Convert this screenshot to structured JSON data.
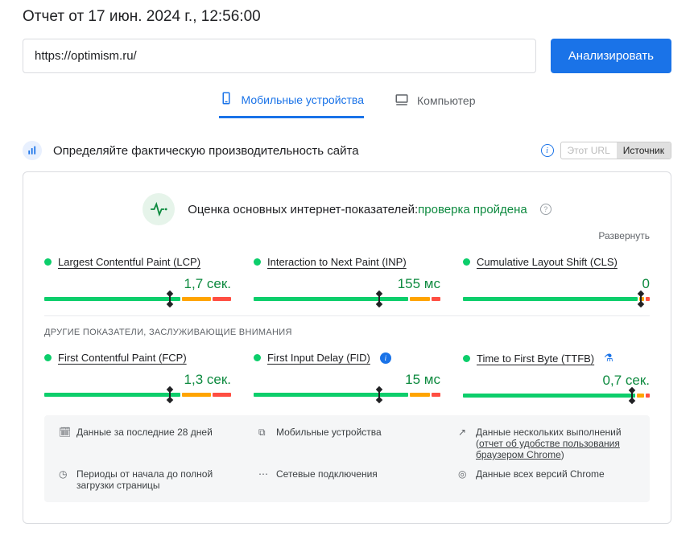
{
  "report_title": "Отчет от 17 июн. 2024 г., 12:56:00",
  "url_value": "https://optimism.ru/",
  "analyze_label": "Анализировать",
  "tabs": {
    "mobile": "Мобильные устройства",
    "desktop": "Компьютер"
  },
  "section": {
    "title": "Определяйте фактическую производительность сайта",
    "toggle_this_url": "Этот URL",
    "toggle_source": "Источник"
  },
  "assessment": {
    "prefix": "Оценка основных интернет-показателей:",
    "result": "проверка пройдена",
    "expand": "Развернуть"
  },
  "metrics_core": [
    {
      "name": "Largest Contentful Paint (LCP)",
      "value": "1,7 сек.",
      "bar": [
        74,
        16,
        10
      ],
      "marker": 67
    },
    {
      "name": "Interaction to Next Paint (INP)",
      "value": "155 мс",
      "bar": [
        84,
        11,
        5
      ],
      "marker": 67
    },
    {
      "name": "Cumulative Layout Shift (CLS)",
      "value": "0",
      "bar": [
        95,
        3,
        2
      ],
      "marker": 95
    }
  ],
  "other_heading": "ДРУГИЕ ПОКАЗАТЕЛИ, ЗАСЛУЖИВАЮЩИЕ ВНИМАНИЯ",
  "metrics_other": [
    {
      "name": "First Contentful Paint (FCP)",
      "value": "1,3 сек.",
      "bar": [
        74,
        16,
        10
      ],
      "marker": 67,
      "suffix": ""
    },
    {
      "name": "First Input Delay (FID)",
      "value": "15 мс",
      "bar": [
        84,
        11,
        5
      ],
      "marker": 67,
      "suffix": "info"
    },
    {
      "name": "Time to First Byte (TTFB)",
      "value": "0,7 сек.",
      "bar": [
        94,
        4,
        2
      ],
      "marker": 90,
      "suffix": "flask"
    }
  ],
  "footer": {
    "period_28": "Данные за последние 28 дней",
    "mobile": "Мобильные устройства",
    "multi_runs": "Данные нескольких выполнений (",
    "multi_runs_link": "отчет об удобстве пользования браузером Chrome",
    "multi_runs_close": ")",
    "full_load": "Периоды от начала до полной загрузки страницы",
    "network": "Сетевые подключения",
    "all_chrome": "Данные всех версий Chrome"
  }
}
